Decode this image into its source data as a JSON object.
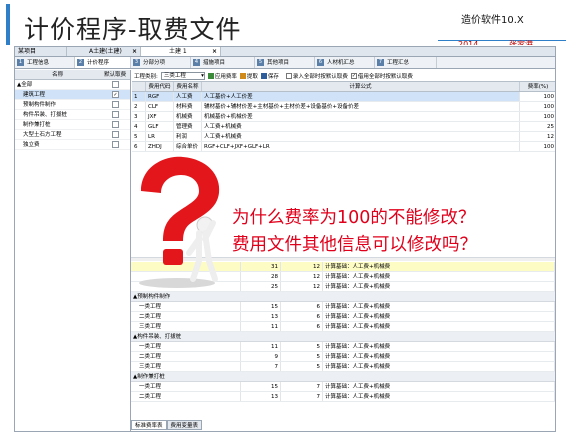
{
  "header": {
    "title": "计价程序-取费文件",
    "brand": "造价软件10.X",
    "cut_left": "2014",
    "cut_right": "张家港"
  },
  "doc_tabs": [
    {
      "label": "某项目"
    },
    {
      "label": "A土建(土建)"
    },
    {
      "label": "土建 1",
      "active": true
    }
  ],
  "main_tabs": [
    {
      "num": "1",
      "label": "工程信息"
    },
    {
      "num": "2",
      "label": "计价程序",
      "active": true
    },
    {
      "num": "3",
      "label": "分部分项"
    },
    {
      "num": "4",
      "label": "措施项目"
    },
    {
      "num": "5",
      "label": "其他项目"
    },
    {
      "num": "6",
      "label": "人材机汇总"
    },
    {
      "num": "7",
      "label": "工程汇总"
    }
  ],
  "left_panel": {
    "col_name": "名称",
    "col_default": "默认取费",
    "rows": [
      {
        "name": "▲全部",
        "checked": false
      },
      {
        "name": "建筑工程",
        "checked": true,
        "selected": true
      },
      {
        "name": "预制构件制作",
        "checked": false
      },
      {
        "name": "构件吊装、打拔桩",
        "checked": false
      },
      {
        "name": "制作兼打桩",
        "checked": false
      },
      {
        "name": "大型土石方工程",
        "checked": false
      },
      {
        "name": "独立费",
        "checked": false
      }
    ]
  },
  "toolbar": {
    "category_label": "工程类别:",
    "category_value": "三类工程",
    "apply_rate": "应用费率",
    "extract": "提取",
    "save": "保存",
    "opt1": "录入全部时按默认取费",
    "opt2": "借用全部时按默认取费",
    "opt2_checked": "✓"
  },
  "fee_table": {
    "headers": {
      "seq": "",
      "code": "费用代码",
      "name": "费用名称",
      "formula": "计算公式",
      "rate": "费率(%)"
    },
    "rows": [
      {
        "seq": "1",
        "code": "RGF",
        "name": "人工费",
        "formula": "人工基价+人工价差",
        "rate": "100",
        "selected": true
      },
      {
        "seq": "2",
        "code": "CLF",
        "name": "材料费",
        "formula": "辅材基价+辅材价差+主材基价+主材价差+设备基价+设备价差",
        "rate": "100"
      },
      {
        "seq": "3",
        "code": "JXF",
        "name": "机械费",
        "formula": "机械基价+机械价差",
        "rate": "100"
      },
      {
        "seq": "4",
        "code": "GLF",
        "name": "管理费",
        "formula": "人工费+机械费",
        "rate": "25"
      },
      {
        "seq": "5",
        "code": "LR",
        "name": "利润",
        "formula": "人工费+机械费",
        "rate": "12"
      },
      {
        "seq": "6",
        "code": "ZHDJ",
        "name": "综合单价",
        "formula": "RGF+CLF+JXF+GLF+LR",
        "rate": "100"
      }
    ]
  },
  "question": {
    "line1": "为什么费率为100的不能修改？",
    "line2": "费用文件其他信息可以修改吗？"
  },
  "rate_table": {
    "top_rows": [
      {
        "name": "",
        "a": "31",
        "b": "12",
        "basis": "计算基础：人工费+机械费",
        "yellow": true
      },
      {
        "name": "",
        "a": "28",
        "b": "12",
        "basis": "计算基础：人工费+机械费"
      },
      {
        "name": "",
        "a": "25",
        "b": "12",
        "basis": "计算基础：人工费+机械费"
      }
    ],
    "groups": [
      {
        "title": "▲预制构件制作",
        "rows": [
          {
            "name": "一类工程",
            "a": "15",
            "b": "6",
            "basis": "计算基础：人工费+机械费"
          },
          {
            "name": "二类工程",
            "a": "13",
            "b": "6",
            "basis": "计算基础：人工费+机械费"
          },
          {
            "name": "三类工程",
            "a": "11",
            "b": "6",
            "basis": "计算基础：人工费+机械费"
          }
        ]
      },
      {
        "title": "▲构件吊装、打拔桩",
        "rows": [
          {
            "name": "一类工程",
            "a": "11",
            "b": "5",
            "basis": "计算基础：人工费+机械费"
          },
          {
            "name": "二类工程",
            "a": "9",
            "b": "5",
            "basis": "计算基础：人工费+机械费"
          },
          {
            "name": "三类工程",
            "a": "7",
            "b": "5",
            "basis": "计算基础：人工费+机械费"
          }
        ]
      },
      {
        "title": "▲制作兼打桩",
        "rows": [
          {
            "name": "一类工程",
            "a": "15",
            "b": "7",
            "basis": "计算基础：人工费+机械费"
          },
          {
            "name": "二类工程",
            "a": "13",
            "b": "7",
            "basis": "计算基础：人工费+机械费"
          }
        ]
      }
    ]
  },
  "bottom_tabs": [
    {
      "label": "标准费率表",
      "active": true
    },
    {
      "label": "费用变量表"
    }
  ],
  "colors": {
    "accent": "#2e7fc8",
    "question_red": "#e0001b",
    "selection": "#cfe2f7"
  }
}
